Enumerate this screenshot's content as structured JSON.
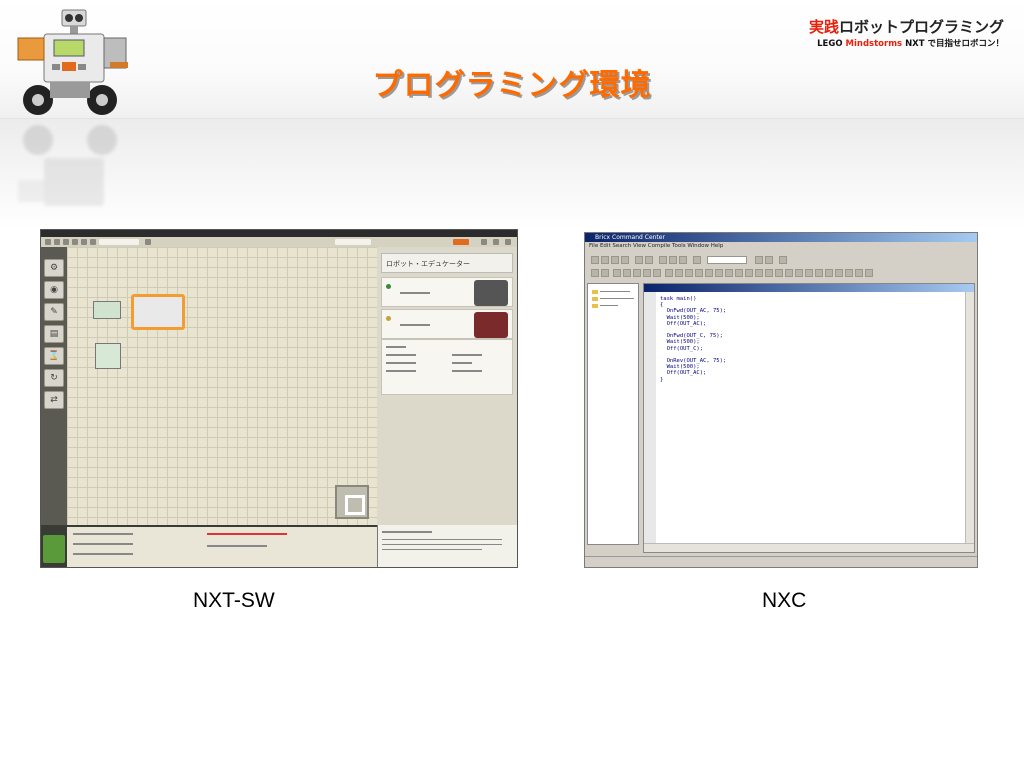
{
  "slide": {
    "title": "プログラミング環境",
    "brand": {
      "line1_accent": "実践",
      "line1_rest": "ロボットプログラミング",
      "line2_part1": "LEGO ",
      "line2_accent": "Mindstorms",
      "line2_part2": " NXT で目指せロボコン！"
    }
  },
  "screenshots": {
    "left": {
      "caption": "NXT-SW",
      "right_panel_heading": "ロボット・エデュケーター"
    },
    "right": {
      "caption": "NXC",
      "window_title": "Bricx Command Center",
      "menu": "File   Edit   Search   View   Compile   Tools   Window   Help",
      "code": "task main()\n{\n  OnFwd(OUT_AC, 75);\n  Wait(500);\n  Off(OUT_AC);\n\n  OnFwd(OUT_C, 75);\n  Wait(500);\n  Off(OUT_C);\n\n  OnRev(OUT_AC, 75);\n  Wait(500);\n  Off(OUT_AC);\n}"
    }
  },
  "colors": {
    "title": "#ff6a00",
    "brand_accent": "#e8200c",
    "nxt_selection": "#f39c34",
    "nxc_titlebar": "#0a246a"
  }
}
